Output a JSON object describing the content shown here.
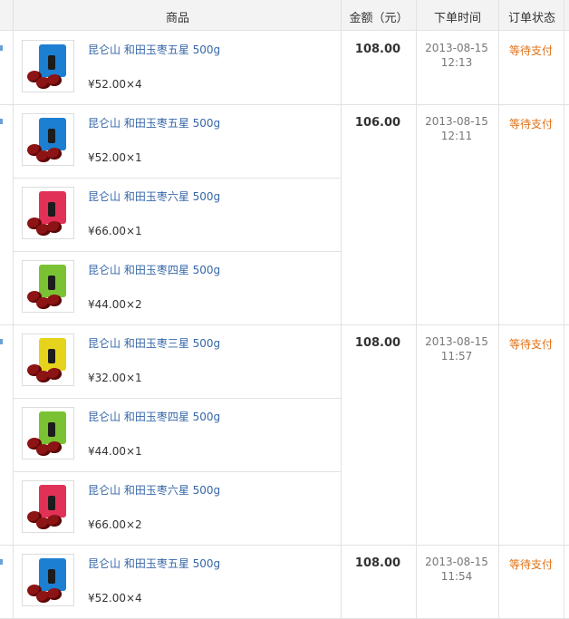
{
  "header": {
    "product": "商品",
    "amount": "金额（元）",
    "order_time": "下单时间",
    "order_status": "订单状态"
  },
  "orders": [
    {
      "amount": "108.00",
      "date": "2013-08-15",
      "time": "12:13",
      "status": "等待支付",
      "items": [
        {
          "name": "昆仑山 和田玉枣五星 500g",
          "price": "¥52.00×4",
          "pack_color": "blue"
        }
      ]
    },
    {
      "amount": "106.00",
      "date": "2013-08-15",
      "time": "12:11",
      "status": "等待支付",
      "items": [
        {
          "name": "昆仑山 和田玉枣五星 500g",
          "price": "¥52.00×1",
          "pack_color": "blue"
        },
        {
          "name": "昆仑山 和田玉枣六星 500g",
          "price": "¥66.00×1",
          "pack_color": "red"
        },
        {
          "name": "昆仑山 和田玉枣四星 500g",
          "price": "¥44.00×2",
          "pack_color": "green"
        }
      ]
    },
    {
      "amount": "108.00",
      "date": "2013-08-15",
      "time": "11:57",
      "status": "等待支付",
      "items": [
        {
          "name": "昆仑山 和田玉枣三星 500g",
          "price": "¥32.00×1",
          "pack_color": "yellow"
        },
        {
          "name": "昆仑山 和田玉枣四星 500g",
          "price": "¥44.00×1",
          "pack_color": "green"
        },
        {
          "name": "昆仑山 和田玉枣六星 500g",
          "price": "¥66.00×2",
          "pack_color": "red"
        }
      ]
    },
    {
      "amount": "108.00",
      "date": "2013-08-15",
      "time": "11:54",
      "status": "等待支付",
      "items": [
        {
          "name": "昆仑山 和田玉枣五星 500g",
          "price": "¥52.00×4",
          "pack_color": "blue"
        }
      ]
    }
  ],
  "colors": {
    "link": "#3667a8",
    "status": "#e07016",
    "header_bg": "#f3f3f3",
    "border": "#e2e2e2"
  }
}
